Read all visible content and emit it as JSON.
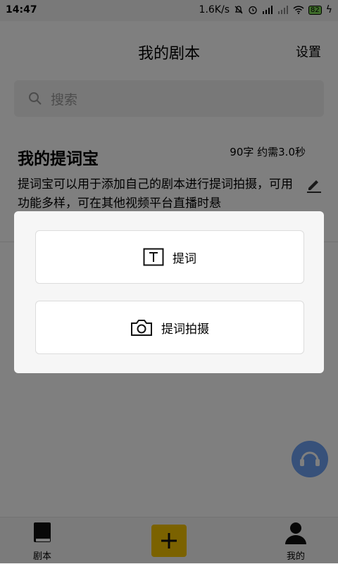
{
  "status_bar": {
    "time": "14:47",
    "speed": "1.6K/s",
    "battery": "82"
  },
  "header": {
    "title": "我的剧本",
    "settings_label": "设置"
  },
  "search": {
    "placeholder": "搜索"
  },
  "script_card": {
    "title": "我的提词宝",
    "meta": "90字  约需3.0秒",
    "description": "提词宝可以用于添加自己的剧本进行提词拍摄，可用功能多样，可在其他视频平台直播时悬"
  },
  "dialog": {
    "options": [
      {
        "label": "提词",
        "icon": "text-box-icon"
      },
      {
        "label": "提词拍摄",
        "icon": "camera-icon"
      }
    ]
  },
  "tabbar": {
    "scripts_label": "剧本",
    "mine_label": "我的",
    "add_icon": "plus-icon"
  },
  "colors": {
    "accent": "#f6c400",
    "fab": "#6ea3f5",
    "overlay": "rgba(0,0,0,0.5)"
  }
}
